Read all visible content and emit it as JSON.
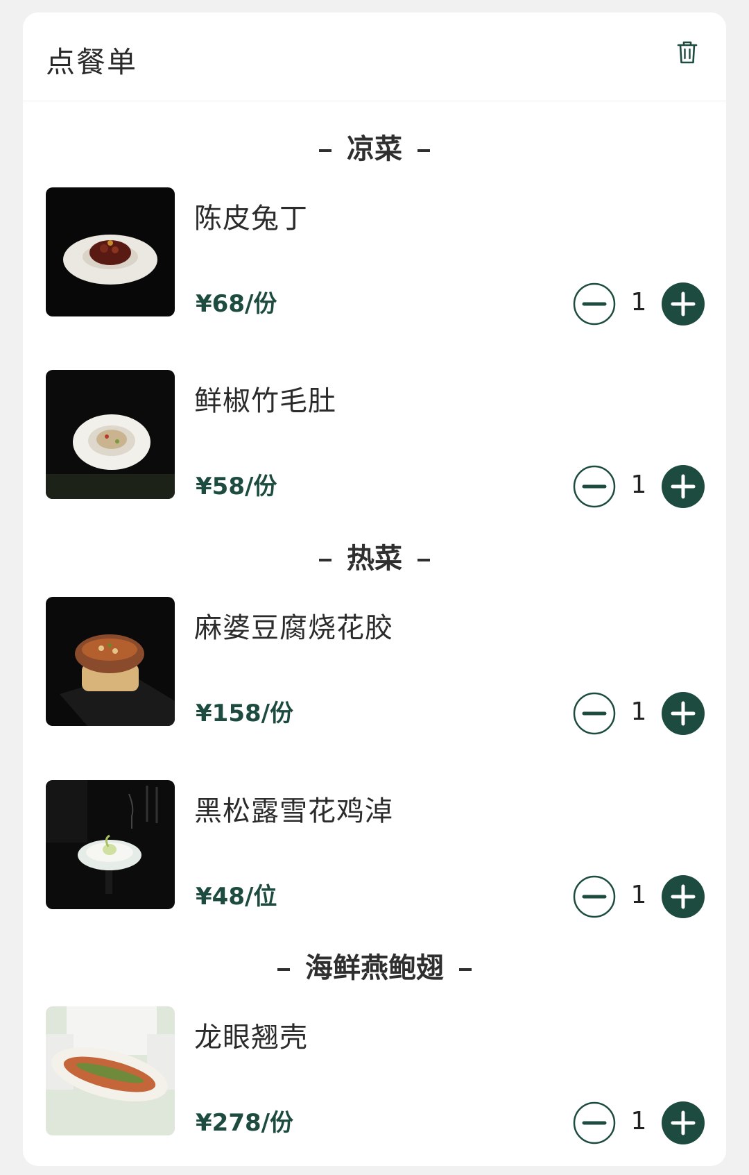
{
  "header": {
    "title": "点餐单",
    "clear_icon": "trash-icon"
  },
  "colors": {
    "accent": "#1d4b3f",
    "background": "#f1f1f1",
    "card": "#ffffff"
  },
  "sections": [
    {
      "title": "凉菜",
      "items": [
        {
          "name": "陈皮兔丁",
          "price": "¥68/份",
          "qty": "1"
        },
        {
          "name": "鲜椒竹毛肚",
          "price": "¥58/份",
          "qty": "1"
        }
      ]
    },
    {
      "title": "热菜",
      "items": [
        {
          "name": "麻婆豆腐烧花胶",
          "price": "¥158/份",
          "qty": "1"
        },
        {
          "name": "黑松露雪花鸡淖",
          "price": "¥48/位",
          "qty": "1"
        }
      ]
    },
    {
      "title": "海鲜燕鲍翅",
      "items": [
        {
          "name": "龙眼翘壳",
          "price": "¥278/份",
          "qty": "1"
        }
      ]
    }
  ]
}
